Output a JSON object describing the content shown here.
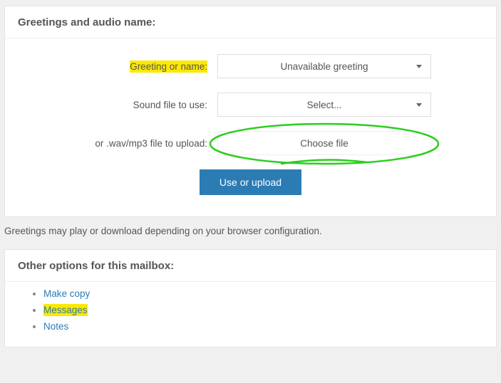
{
  "panel1": {
    "title": "Greetings and audio name:",
    "row_greeting": {
      "label": "Greeting or name:",
      "value": "Unavailable greeting"
    },
    "row_sound": {
      "label": "Sound file to use:",
      "value": "Select..."
    },
    "row_upload": {
      "label": "or .wav/mp3 file to upload:",
      "value": "Choose file"
    },
    "button": "Use or upload"
  },
  "note": "Greetings may play or download depending on your browser configuration.",
  "panel2": {
    "title": "Other options for this mailbox:",
    "links": [
      "Make copy",
      "Messages",
      "Notes"
    ]
  }
}
